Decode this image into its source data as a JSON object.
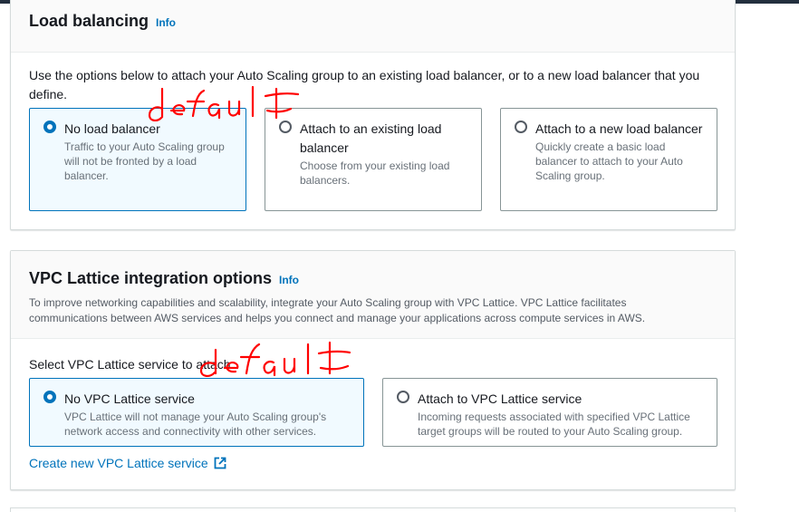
{
  "load_balancing": {
    "title": "Load balancing",
    "info": "Info",
    "description": "Use the options below to attach your Auto Scaling group to an existing load balancer, or to a new load balancer that you define.",
    "options": [
      {
        "label": "No load balancer",
        "description": "Traffic to your Auto Scaling group will not be fronted by a load balancer.",
        "selected": true
      },
      {
        "label": "Attach to an existing load balancer",
        "description": "Choose from your existing load balancers.",
        "selected": false
      },
      {
        "label": "Attach to a new load balancer",
        "description": "Quickly create a basic load balancer to attach to your Auto Scaling group.",
        "selected": false
      }
    ]
  },
  "vpc_lattice": {
    "title": "VPC Lattice integration options",
    "info": "Info",
    "description": "To improve networking capabilities and scalability, integrate your Auto Scaling group with VPC Lattice. VPC Lattice facilitates communications between AWS services and helps you connect and manage your applications across compute services in AWS.",
    "select_label": "Select VPC Lattice service to attach",
    "options": [
      {
        "label": "No VPC Lattice service",
        "description": "VPC Lattice will not manage your Auto Scaling group's network access and connectivity with other services.",
        "selected": true
      },
      {
        "label": "Attach to VPC Lattice service",
        "description": "Incoming requests associated with specified VPC Lattice target groups will be routed to your Auto Scaling group.",
        "selected": false
      }
    ],
    "create_link": "Create new VPC Lattice service"
  },
  "annotations": {
    "first": "default",
    "second": "default",
    "color": "#ff0000"
  },
  "colors": {
    "accent": "#0073bb",
    "selected_bg": "#f1faff",
    "border": "#879596"
  },
  "icons": {
    "external_link": "external-link-icon"
  }
}
